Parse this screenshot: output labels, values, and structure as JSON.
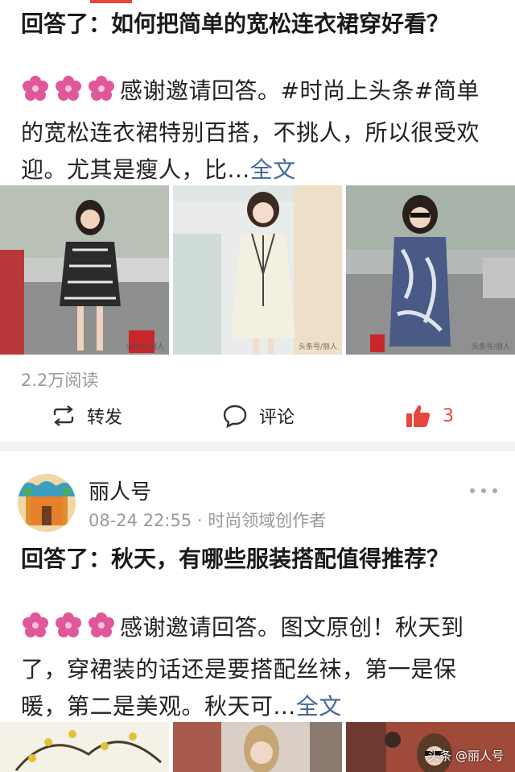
{
  "colors": {
    "accent": "#e8453c",
    "link": "#406599",
    "muted": "#999999",
    "flower": "#e0589a"
  },
  "posts": [
    {
      "title": "回答了：如何把简单的宽松连衣裙穿好看？",
      "excerpt": "感谢邀请回答。#时尚上头条#简单的宽松连衣裙特别百搭，不挑人，所以很受欢迎。尤其是瘦人，比...",
      "full_link": "全文",
      "image_watermark": "头条号/丽人",
      "reads": "2.2万阅读",
      "actions": {
        "repost": "转发",
        "comment": "评论",
        "like_count": "3"
      }
    },
    {
      "author": "丽人号",
      "meta": "08-24 22:55 · 时尚领域创作者",
      "title": "回答了：秋天，有哪些服装搭配值得推荐？",
      "excerpt": "感谢邀请回答。图文原创！秋天到了，穿裙装的话还是要搭配丝袜，第一是保暖，第二是美观。秋天可...",
      "full_link": "全文"
    }
  ],
  "icons": [
    "flower-icon",
    "repost-icon",
    "comment-icon",
    "like-icon",
    "more-icon"
  ],
  "watermark": "头条 @丽人号"
}
